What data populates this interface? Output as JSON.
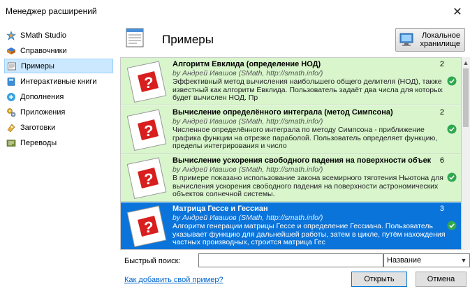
{
  "window": {
    "title": "Менеджер расширений",
    "close_glyph": "✕"
  },
  "sidebar": {
    "items": [
      {
        "label": "SMath Studio",
        "icon": "smath-icon"
      },
      {
        "label": "Справочники",
        "icon": "books-icon"
      },
      {
        "label": "Примеры",
        "icon": "document-icon",
        "selected": true
      },
      {
        "label": "Интерактивные книги",
        "icon": "interactive-book-icon"
      },
      {
        "label": "Дополнения",
        "icon": "plugin-icon"
      },
      {
        "label": "Приложения",
        "icon": "gears-icon"
      },
      {
        "label": "Заготовки",
        "icon": "snippet-icon"
      },
      {
        "label": "Переводы",
        "icon": "translation-icon"
      }
    ]
  },
  "header": {
    "title": "Примеры",
    "local_storage_label": "Локальное хранилище"
  },
  "list": {
    "items": [
      {
        "title": "Алгоритм Евклида (определение НОД)",
        "author": "by Андрей Ивашов (SMath, http://smath.info/)",
        "description": "Эффективный метод вычисления наибольшего общего делителя (НОД), также известный как алгоритм Евклида. Пользователь задаёт два числа для которых будет вычислен НОД. Пр",
        "count": "2"
      },
      {
        "title": "Вычисление определённого интеграла (метод Симпсона)",
        "author": "by Андрей Ивашов (SMath, http://smath.info/)",
        "description": "Численное определённого интеграла по методу Симпсона - приближение графика функции на отрезке параболой. Пользователь определяет функцию, пределы интегрирования и число",
        "count": "2"
      },
      {
        "title": "Вычисление ускорения свободного падения на поверхности объек",
        "author": "by Андрей Ивашов (SMath, http://smath.info/)",
        "description": "В примере показано использование закона всемирного тяготения Ньютона для вычисления ускорения свободного падения на поверхности астрономических объектов солнечной системы.",
        "count": "6"
      },
      {
        "title": "Матрица Гессе и Гессиан",
        "author": "by Андрей Ивашов (SMath, http://smath.info/)",
        "description": "Алгоритм генерации матрицы Гессе и определение Гессиана. Пользователь указывает функцию для дальнейшей работы, затем в цикле, путём нахождения частных производных, строится матрица Гес",
        "count": "3",
        "selected": true
      }
    ]
  },
  "search": {
    "label": "Быстрый поиск:",
    "value": "",
    "placeholder": "",
    "sort_value": "Название"
  },
  "footer": {
    "help_link": "Как добавить свой пример?",
    "open_label": "Открыть",
    "cancel_label": "Отмена"
  },
  "colors": {
    "item_bg": "#d8f5cc",
    "selected_bg": "#0a74da",
    "check_green": "#2fa84f",
    "icon_red": "#d81e1e"
  }
}
